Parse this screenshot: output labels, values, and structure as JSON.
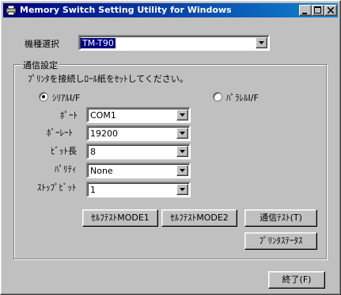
{
  "window": {
    "title": "Memory Switch Setting Utility for Windows",
    "controls": [
      "_",
      "□",
      "✕"
    ]
  },
  "model": {
    "label": "機種選択",
    "value": "TM-T90"
  },
  "comm": {
    "group_label": "通信設定",
    "instruction": "ﾌﾟﾘﾝﾀを接続しﾛｰﾙ紙をｾｯﾄしてください。",
    "serial_label": "ｼﾘｱﾙI/F",
    "parallel_label": "ﾊﾟﾗﾚﾙI/F",
    "serial_selected": true,
    "fields": [
      {
        "label": "ﾎﾟｰﾄ",
        "value": "COM1"
      },
      {
        "label": "ﾎﾞｰﾚｰﾄ",
        "value": "19200"
      },
      {
        "label": "ﾋﾞｯﾄ長",
        "value": "8"
      },
      {
        "label": "ﾊﾟﾘﾃｨ",
        "value": "None"
      },
      {
        "label": "ｽﾄｯﾌﾟﾋﾞｯﾄ",
        "value": "1"
      }
    ]
  },
  "buttons": {
    "self_test1": "ｾﾙﾌﾃｽﾄMODE1",
    "self_test2": "ｾﾙﾌﾃｽﾄMODE2",
    "comm_test": "通信ﾃｽﾄ(T)",
    "printer_status": "ﾌﾟﾘﾝﾀｽﾃｰﾀｽ",
    "exit": "終了(F)"
  }
}
